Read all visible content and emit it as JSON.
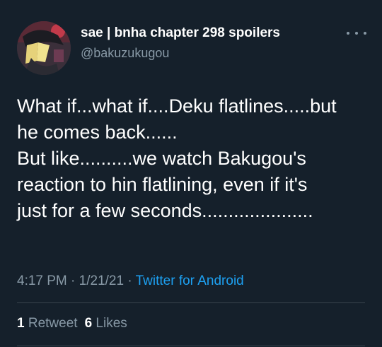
{
  "user": {
    "display_name": "sae | bnha chapter 298 spoilers",
    "handle": "@bakuzukugou",
    "avatar_icon": "anime-avatar-image"
  },
  "tweet": {
    "lines": [
      "What if...what if....Deku flatlines.....but",
      "he comes back......",
      "But like..........we watch Bakugou's",
      "reaction to hin flatlining, even if it's",
      "just for a few seconds....................."
    ]
  },
  "meta": {
    "time": "4:17 PM",
    "separator": "·",
    "date": "1/21/21",
    "source": "Twitter for Android"
  },
  "stats": {
    "retweet_count": "1",
    "retweet_label": "Retweet",
    "like_count": "6",
    "like_label": "Likes"
  },
  "colors": {
    "background": "#15202b",
    "secondary_text": "#8899a6",
    "accent": "#1da1f2",
    "divider": "#38444d"
  }
}
